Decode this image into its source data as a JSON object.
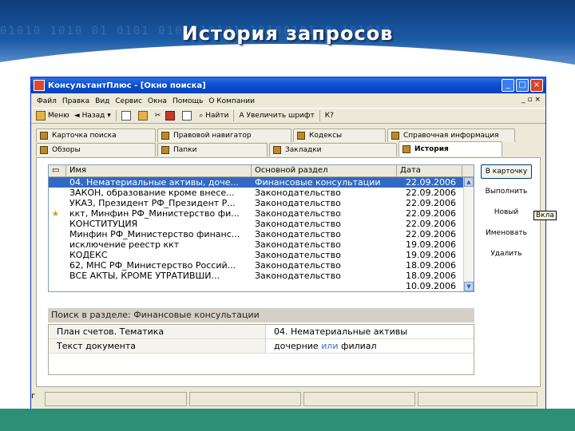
{
  "slide": {
    "title": "История запросов",
    "binary_text": "01010  1010 01  0101   0101010101  10100101 0  101010"
  },
  "window": {
    "title": "КонсультантПлюс - [Окно поиска]",
    "controls": {
      "minimize": "_",
      "maximize": "□",
      "close": "×"
    }
  },
  "menu": {
    "items": [
      "Файл",
      "Правка",
      "Вид",
      "Сервис",
      "Окна",
      "Помощь",
      "О Компании"
    ],
    "mdi_controls": "_ ▫ ×"
  },
  "toolbar": {
    "menu_label": "Меню",
    "back_label": "Назад",
    "find_label": "Найти",
    "zoom_label": "Увеличить шрифт",
    "help_label": "К?"
  },
  "tabs": {
    "row1": [
      "Карточка поиска",
      "Правовой навигатор",
      "Кодексы",
      "Справочная информация"
    ],
    "row2": [
      "Обзоры",
      "Папки",
      "Закладки",
      "История"
    ]
  },
  "history_list": {
    "headers": {
      "name": "Имя",
      "section": "Основной раздел",
      "date": "Дата"
    },
    "rows": [
      {
        "name": "04. Нематериальные активы, доче...",
        "section": "Финансовые консультации",
        "date": "22.09.2006",
        "selected": true
      },
      {
        "name": "ЗАКОН, образование кроме внесе...",
        "section": "Законодательство",
        "date": "22.09.2006"
      },
      {
        "name": "УКАЗ, Президент РФ_Президент Р...",
        "section": "Законодательство",
        "date": "22.09.2006"
      },
      {
        "name": "ккт, Минфин РФ_Министерство фи...",
        "section": "Законодательство",
        "date": "22.09.2006",
        "starred": true
      },
      {
        "name": "КОНСТИТУЦИЯ",
        "section": "Законодательство",
        "date": "22.09.2006"
      },
      {
        "name": "Минфин РФ_Министерство финанс...",
        "section": "Законодательство",
        "date": "22.09.2006"
      },
      {
        "name": "исключение реестр ккт",
        "section": "Законодательство",
        "date": "19.09.2006"
      },
      {
        "name": "КОДЕКС",
        "section": "Законодательство",
        "date": "19.09.2006"
      },
      {
        "name": "62, МНС РФ_Министерство Россий...",
        "section": "Законодательство",
        "date": "18.09.2006"
      },
      {
        "name": "ВСЕ АКТЫ, КРОМЕ УТРАТИВШИ...",
        "section": "Законодательство",
        "date": "18.09.2006"
      },
      {
        "name": "",
        "section": "",
        "date": "10.09.2006"
      }
    ]
  },
  "side_buttons": {
    "to_card": "В карточку",
    "execute": "Выполнить",
    "new": "Новый",
    "rename": "Именовать",
    "delete": "Удалить",
    "tooltip": "Вкла"
  },
  "search_panel": {
    "title": "Поиск в разделе: Финансовые консультации",
    "rows": [
      {
        "key": "План счетов. Тематика",
        "value": "04. Нематериальные активы"
      },
      {
        "key": "Текст документа",
        "value_pre": "дочерние ",
        "value_em": "или",
        "value_post": " филиал"
      }
    ]
  },
  "status": {
    "left": "г"
  },
  "colors": {
    "selection": "#316ac5",
    "titlebar": "#0a4ed0",
    "slide_band": "#2e8f77"
  }
}
